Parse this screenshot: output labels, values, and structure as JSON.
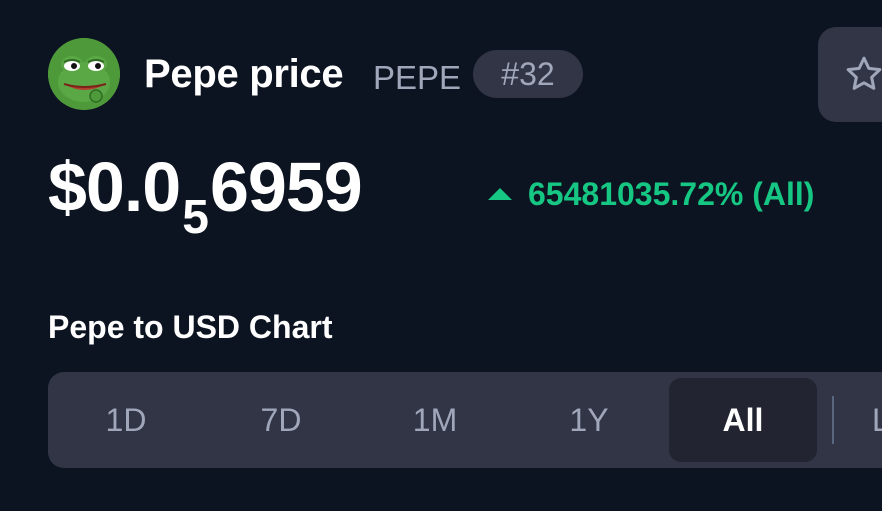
{
  "coin": {
    "name_label": "Pepe price",
    "symbol": "PEPE",
    "rank": "#32",
    "logo_icon": "pepe-frog-icon",
    "watchlist_icon": "star-icon"
  },
  "price": {
    "prefix": "$0.0",
    "zero_count": "5",
    "digits": "6959"
  },
  "change": {
    "direction_icon": "caret-up-icon",
    "value": "65481035.72% (All)",
    "color": "#16c784"
  },
  "chart": {
    "heading": "Pepe to USD Chart"
  },
  "range_tabs": [
    {
      "label": "1D"
    },
    {
      "label": "7D"
    },
    {
      "label": "1M"
    },
    {
      "label": "1Y"
    },
    {
      "label": "All",
      "selected": true
    }
  ],
  "range_extra": {
    "label": "L"
  },
  "colors": {
    "background": "#0d1421",
    "panel": "#323546",
    "selected_tab": "#222531",
    "muted_text": "#a1a7bb",
    "positive": "#16c784"
  }
}
